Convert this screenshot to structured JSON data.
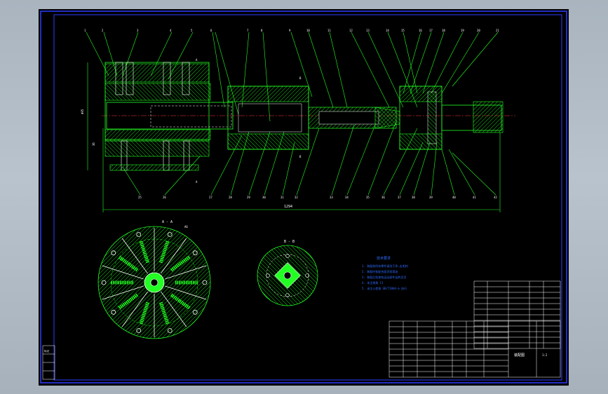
{
  "view": {
    "background": "#000000",
    "frame_color": "#2f3cff",
    "line_color": "#22ff22",
    "accent": "#ffffff"
  },
  "main_view": {
    "part_numbers_top": [
      "1",
      "2",
      "3",
      "4",
      "5",
      "6",
      "7",
      "8",
      "9",
      "10",
      "11",
      "12",
      "13",
      "14",
      "15",
      "16",
      "17",
      "18",
      "19",
      "20",
      "21",
      "22",
      "23",
      "24"
    ],
    "part_numbers_bottom": [
      "25",
      "26",
      "27",
      "28",
      "29",
      "30",
      "31",
      "32",
      "33",
      "34",
      "35",
      "36",
      "37",
      "38",
      "39",
      "40",
      "41",
      "42"
    ],
    "section_mark_a_top": "A",
    "section_mark_a_bottom": "A",
    "section_mark_b_top": "B",
    "section_mark_b_bottom": "B",
    "overall_length": "1294",
    "dia_dim": "Φ95",
    "height_dim": "36"
  },
  "section_aa": {
    "title": "A - A",
    "tag": "A6"
  },
  "section_bb": {
    "title": "B - B"
  },
  "tech_requirements": {
    "title": "技术要求",
    "lines": [
      "1. 装配前所有零件清洗干净,去毛刺",
      "2. 装配时各配合面涂润滑油",
      "3. 装配后检查各运动部件运转灵活",
      "4. 未注倒角 C1",
      "5. 未注公差按 GB/T1804-m 执行"
    ]
  },
  "title_block": {
    "drawing_name": "装配图",
    "scale": "1:2"
  },
  "corner_stamp": {
    "label": "标记"
  }
}
